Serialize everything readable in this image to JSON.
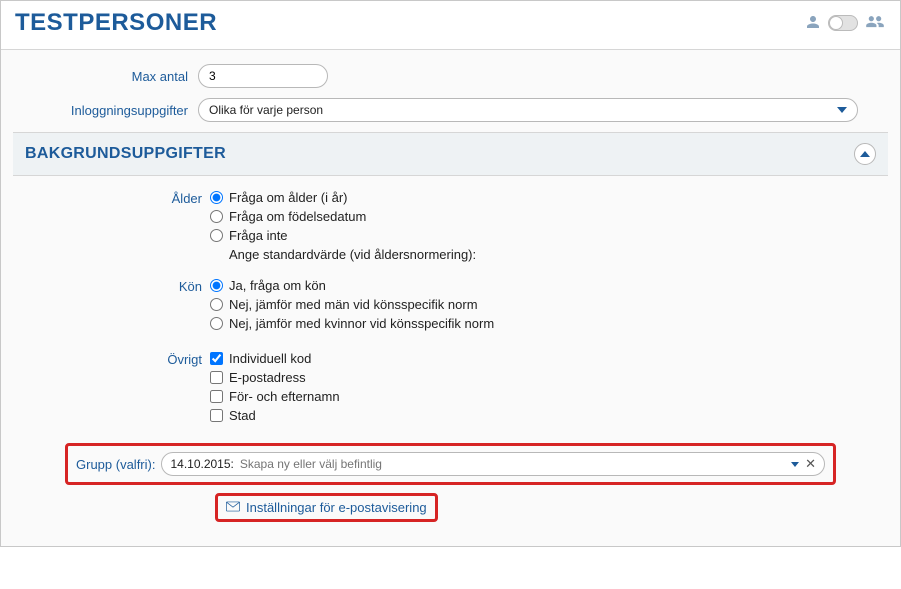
{
  "title": "TESTPERSONER",
  "max_antal": {
    "label": "Max antal",
    "value": "3"
  },
  "inloggning": {
    "label": "Inloggningsuppgifter",
    "value": "Olika för varje person"
  },
  "section": {
    "title": "BAKGRUNDSUPPGIFTER"
  },
  "alder": {
    "label": "Ålder",
    "opt1": "Fråga om ålder (i år)",
    "opt2": "Fråga om födelsedatum",
    "opt3": "Fråga inte",
    "note": "Ange standardvärde (vid åldersnormering):"
  },
  "kon": {
    "label": "Kön",
    "opt1": "Ja, fråga om kön",
    "opt2": "Nej, jämför med män vid könsspecifik norm",
    "opt3": "Nej, jämför med kvinnor vid könsspecifik norm"
  },
  "ovrigt": {
    "label": "Övrigt",
    "opt1": "Individuell kod",
    "opt2": "E-postadress",
    "opt3": "För- och efternamn",
    "opt4": "Stad"
  },
  "grupp": {
    "label": "Grupp (valfri):",
    "prefix": "14.10.2015:",
    "placeholder": "Skapa ny eller välj befintlig"
  },
  "email_link": "Inställningar för e-postavisering"
}
